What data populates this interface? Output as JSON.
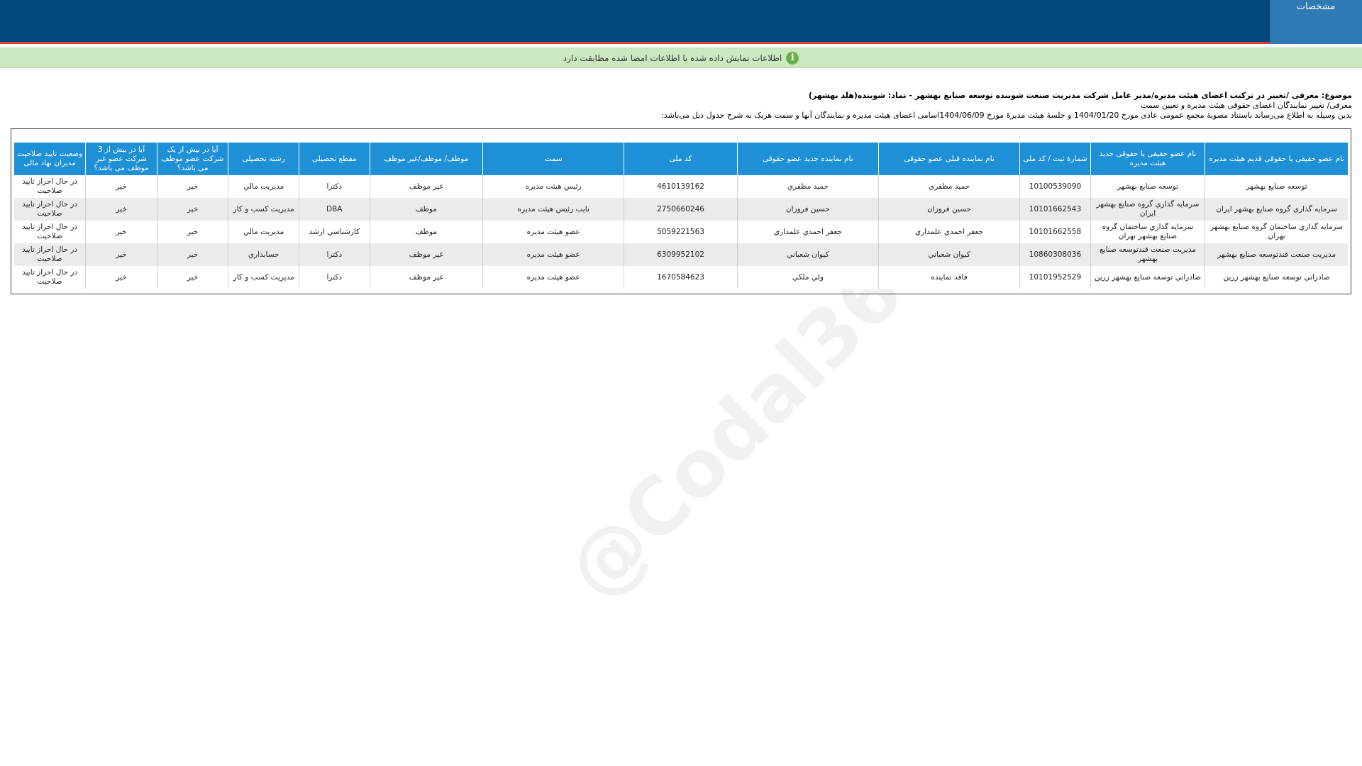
{
  "topbar": {
    "tab_label": "مشخصات"
  },
  "notice": {
    "text": "اطلاعات نمایش داده شده با اطلاعات امضا شده مطابقت دارد"
  },
  "header": {
    "subject": "موضوع: معرفی /تغییر در ترکیب اعضای هیئت مدیره/مدیر عامل شرکت مدیریت صنعت شوینده توسعه صنایع بهشهر - نماد: شوینده(هلد بهشهر)",
    "line2": "معرفی/ تغییر نمایندگان اعضای حقوقی هیئت مدیره و تعیین سمت",
    "line3": "بدین وسیله به اطلاع می‌رساند باستناد مصوبهٔ مجمع عمومی عادی مورخ  1404/01/20  و جلسهٔ هیئت مدیرهٔ مورخ  1404/06/09اسامی اعضای هیئت مدیره و نمایندگان آنها و سمت هریک به شرح جدول ذیل می‌باشد:"
  },
  "table": {
    "headers": [
      "نام عضو حقیقی یا حقوقی قدیم هیئت مدیره",
      "نام عضو حقیقی یا حقوقی جدید هیئت مدیره",
      "شمارهٔ ثبت / کد ملی",
      "نام نماینده قبلی عضو حقوقی",
      "نام نماینده جدید عضو حقوقی",
      "کد ملی",
      "سمت",
      "موظف/ موظف/غیر موظف",
      "مقطع تحصیلی",
      "رشته تحصیلی",
      "آیا در بیش از یک شرکت عضو موظف می باشد؟",
      "آیا در بیش از 3 شرکت عضو غیر موظف می باشد؟",
      "وضعیت تایید صلاحیت مدیران نهاد مالی"
    ],
    "rows": [
      [
        "توسعه صنایع بهشهر",
        "توسعه صنایع بهشهر",
        "10100539090",
        "حميد مظفري",
        "حميد مظفري",
        "4610139162",
        "رئیس هیئت مدیره",
        "غیر موظف",
        "دکترا",
        "مديريت مالي",
        "خیر",
        "خیر",
        "در حال احراز تایید صلاحیت"
      ],
      [
        "سرمايه گذاري گروه صنايع بهشهر ايران",
        "سرمايه گذاري گروه صنايع بهشهر ايران",
        "10101662543",
        "حسين فروزان",
        "حسين فروزان",
        "2750660246",
        "نایب رئیس هیئت مدیره",
        "موظف",
        "DBA",
        "مديريت کسب و کار",
        "خیر",
        "خیر",
        "در حال احراز تایید صلاحیت"
      ],
      [
        "سرمايه گذاري ساختمان گروه صنايع بهشهر تهران",
        "سرمايه گذاري ساختمان گروه صنايع بهشهر تهران",
        "10101662558",
        "جعفر احمدي علمداري",
        "جعفر احمدي علمداري",
        "5059221563",
        "عضو هیئت مدیره",
        "موظف",
        "کارشناسي ارشد",
        "مديريت مالي",
        "خیر",
        "خیر",
        "در حال احراز تایید صلاحیت"
      ],
      [
        "مديريت صنعت قندتوسعه صنايع بهشهر",
        "مديريت صنعت قندتوسعه صنايع بهشهر",
        "10860308036",
        "کيوان شعباني",
        "کيوان شعباني",
        "6309952102",
        "عضو هیئت مدیره",
        "غیر موظف",
        "دکترا",
        "حسابداري",
        "خیر",
        "خیر",
        "در حال احراز تایید صلاحیت"
      ],
      [
        "صادراتي توسعه صنايع بهشهر زرين",
        "صادراتي توسعه صنايع بهشهر زرين",
        "10101952529",
        "فاقد نماینده",
        "ولي ملکي",
        "1670584623",
        "عضو هیئت مدیره",
        "غیر موظف",
        "دکترا",
        "مديريت کسب و کار",
        "خیر",
        "خیر",
        "در حال احراز تایید صلاحیت"
      ]
    ]
  },
  "watermark": "@Codal360.ir",
  "colors": {
    "topbar": "#024a7c",
    "tab": "#2f79b5",
    "notice_bg": "#cbe8c0",
    "table_header": "#1e90d6",
    "accent_red": "#e53935"
  }
}
